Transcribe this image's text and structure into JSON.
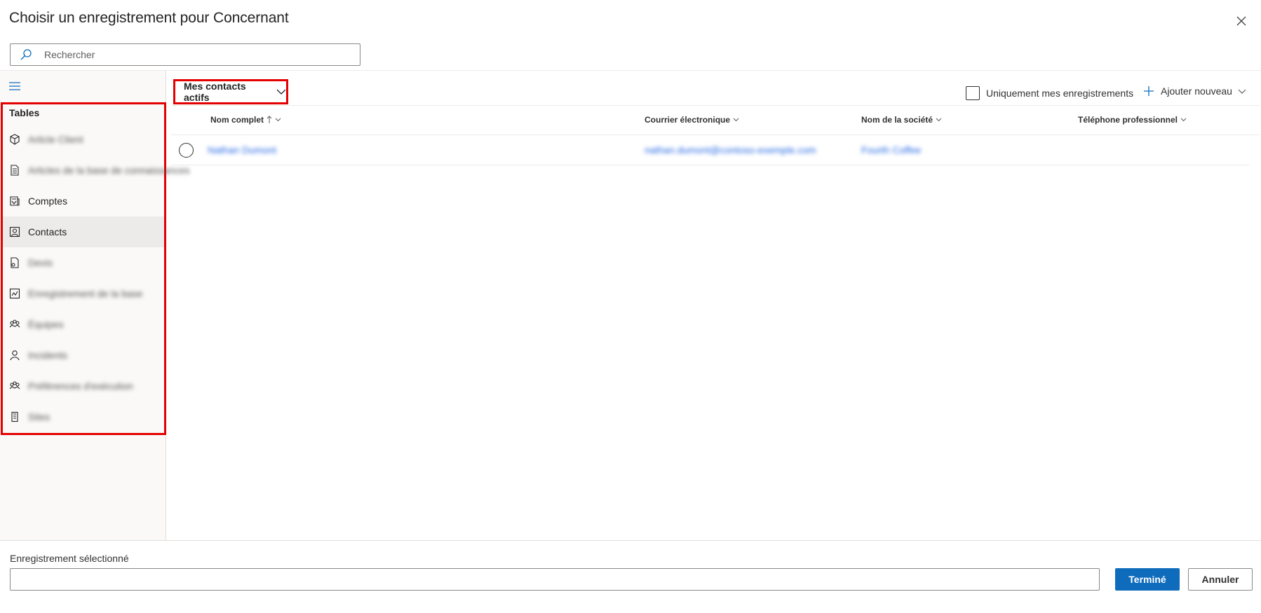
{
  "dialog": {
    "title": "Choisir un enregistrement pour Concernant"
  },
  "search": {
    "placeholder": "Rechercher",
    "value": ""
  },
  "sidebar": {
    "heading": "Tables",
    "items": [
      {
        "label": "Article Client",
        "icon": "cube-icon",
        "obscured": true
      },
      {
        "label": "Articles de la base de connaissances",
        "icon": "document-icon",
        "obscured": true
      },
      {
        "label": "Comptes",
        "icon": "account-icon",
        "obscured": false
      },
      {
        "label": "Contacts",
        "icon": "contact-card-icon",
        "obscured": false
      },
      {
        "label": "Devis",
        "icon": "quote-icon",
        "obscured": true
      },
      {
        "label": "Enregistrement de la base",
        "icon": "knowledge-record-icon",
        "obscured": true
      },
      {
        "label": "Équipes",
        "icon": "team-icon",
        "obscured": true
      },
      {
        "label": "Incidents",
        "icon": "person-icon",
        "obscured": true
      },
      {
        "label": "Préférences d'exécution",
        "icon": "team-icon",
        "obscured": true
      },
      {
        "label": "Sites",
        "icon": "building-icon",
        "obscured": true
      }
    ],
    "selected": "Contacts"
  },
  "view": {
    "selector_label": "Mes contacts actifs",
    "only_mine_label": "Uniquement mes enregistrements",
    "only_mine_checked": false,
    "add_new_label": "Ajouter nouveau"
  },
  "grid": {
    "columns": [
      "Nom complet",
      "Courrier électronique",
      "Nom de la société",
      "Téléphone professionnel"
    ],
    "sort_column": "Nom complet",
    "rows": [
      {
        "name": "Nathan Dumont",
        "email": "nathan.dumont@contoso-exemple.com",
        "company": "Fourth Coffee",
        "phone": ""
      }
    ]
  },
  "footer": {
    "selected_label": "Enregistrement sélectionné",
    "selected_value": "",
    "done_label": "Terminé",
    "cancel_label": "Annuler"
  },
  "colors": {
    "primary": "#0f6cbd",
    "link": "#2266e3",
    "highlight_border": "#e50000"
  }
}
